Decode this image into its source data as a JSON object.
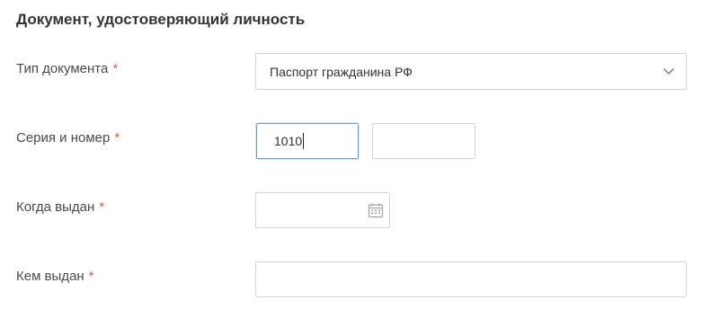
{
  "section": {
    "title": "Документ, удостоверяющий личность"
  },
  "required_mark": "*",
  "fields": {
    "doc_type": {
      "label": "Тип документа",
      "value": "Паспорт гражданина РФ",
      "icon": "chevron-down-icon"
    },
    "series_number": {
      "label": "Серия и номер",
      "series_value": "1010",
      "number_value": ""
    },
    "issue_date": {
      "label": "Когда выдан",
      "value": "",
      "icon": "calendar-icon"
    },
    "issued_by": {
      "label": "Кем выдан",
      "value": ""
    }
  },
  "colors": {
    "required": "#e2574c",
    "focus_border": "#6a9fd8",
    "border": "#d3d3d3"
  }
}
